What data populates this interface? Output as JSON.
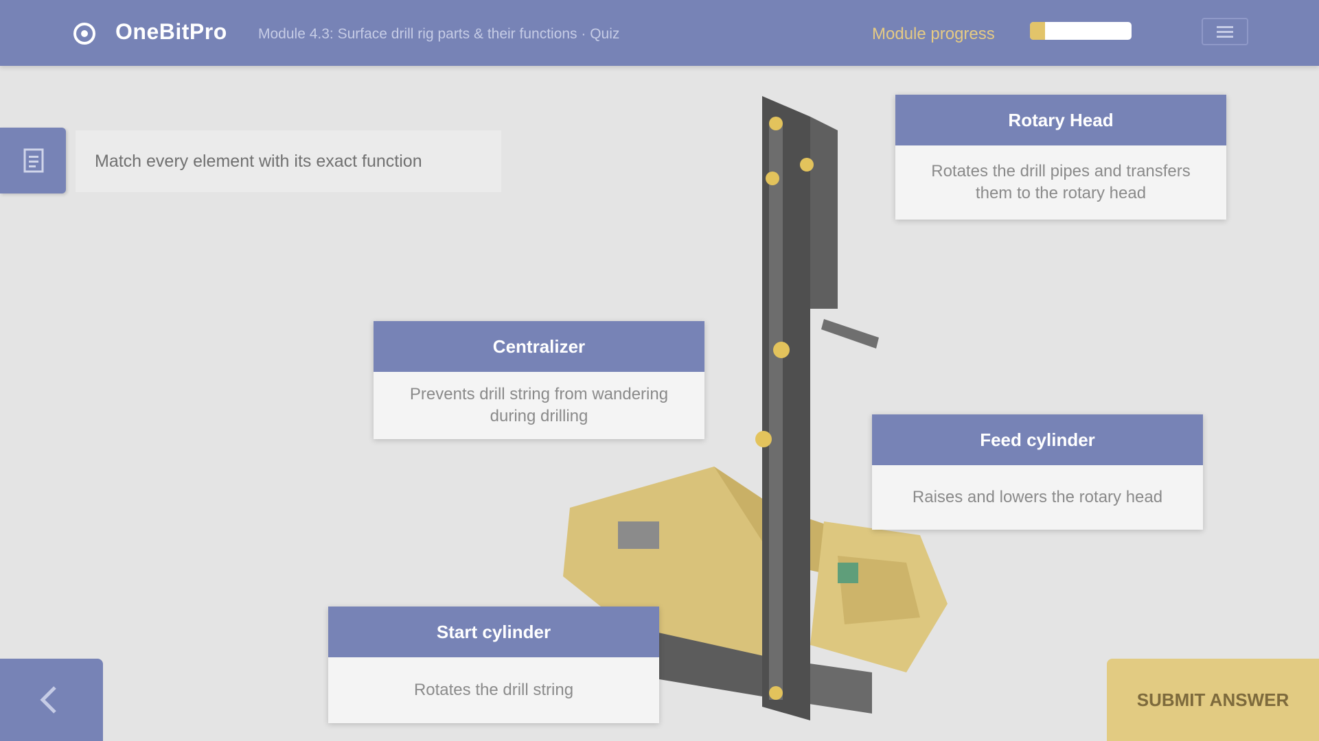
{
  "header": {
    "app_name": "OneBitPro",
    "breadcrumb": "Module 4.3: Surface drill rig parts & their functions · Quiz",
    "progress_label": "Module progress",
    "progress_value": 0.15,
    "menu_icon": "menu-icon",
    "logo_icon": "logo-icon"
  },
  "instruction": {
    "text": "Match every element with its exact function",
    "icon": "list-icon"
  },
  "cards": {
    "rotary_head": {
      "title": "Rotary Head",
      "description": "Rotates the drill pipes and transfers them to the rotary head"
    },
    "centralizer": {
      "title": "Centralizer",
      "description": "Prevents drill string from wandering during drilling"
    },
    "feed_cylinder": {
      "title": "Feed cylinder",
      "description": "Raises and lowers the rotary head"
    },
    "start_cylinder": {
      "title": "Start cylinder",
      "description": "Rotates the drill string"
    }
  },
  "footer": {
    "back_icon": "chevron-left-icon",
    "submit_label": "SUBMIT ANSWER"
  },
  "colors": {
    "primary": "#7783b6",
    "accent": "#e2cb82",
    "background": "#e4e4e4"
  }
}
